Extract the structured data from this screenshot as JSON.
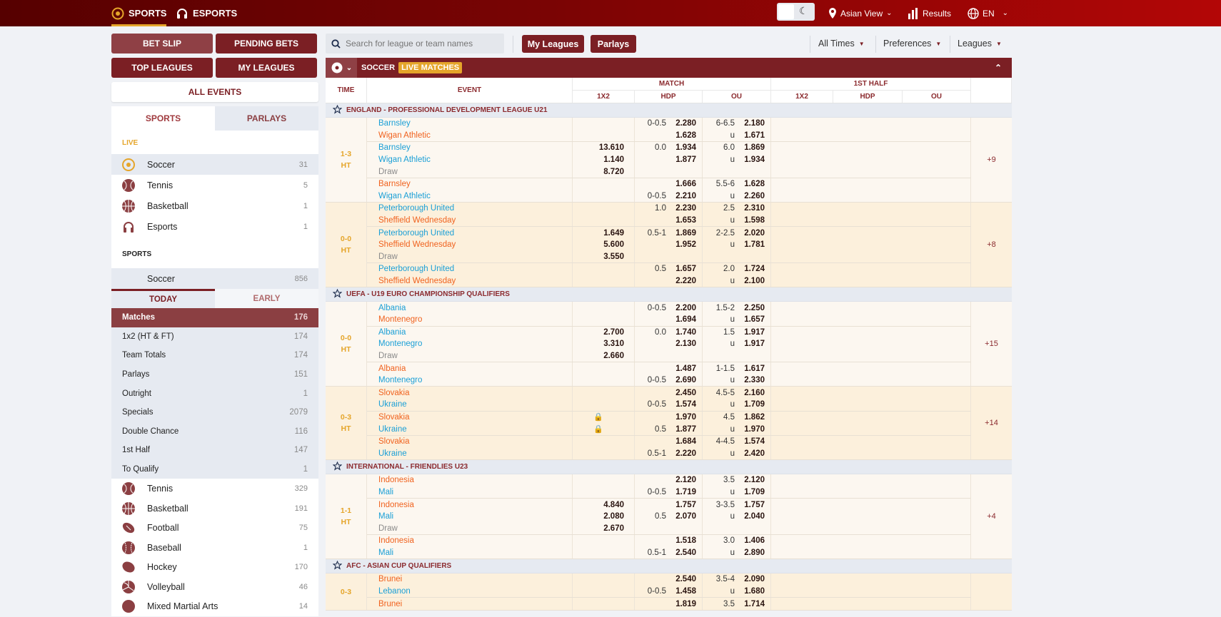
{
  "topbar": {
    "sports": "SPORTS",
    "esports": "ESPORTS",
    "view": "Asian View",
    "results": "Results",
    "lang": "EN"
  },
  "buttons": {
    "bet_slip": "BET SLIP",
    "pending_bets": "PENDING BETS",
    "top_leagues": "TOP LEAGUES",
    "my_leagues": "MY LEAGUES",
    "all_events": "ALL EVENTS"
  },
  "sidebar": {
    "tabs": [
      "SPORTS",
      "PARLAYS"
    ],
    "live_label": "LIVE",
    "live": [
      {
        "name": "Soccer",
        "count": "31",
        "icon": "soccer"
      },
      {
        "name": "Tennis",
        "count": "5",
        "icon": "tennis"
      },
      {
        "name": "Basketball",
        "count": "1",
        "icon": "basketball"
      },
      {
        "name": "Esports",
        "count": "1",
        "icon": "headset"
      }
    ],
    "sports_label": "SPORTS",
    "soccer": {
      "name": "Soccer",
      "count": "856"
    },
    "day_tabs": [
      "TODAY",
      "EARLY"
    ],
    "markets": [
      {
        "name": "Matches",
        "count": "176"
      },
      {
        "name": "1x2 (HT & FT)",
        "count": "174"
      },
      {
        "name": "Team Totals",
        "count": "174"
      },
      {
        "name": "Parlays",
        "count": "151"
      },
      {
        "name": "Outright",
        "count": "1"
      },
      {
        "name": "Specials",
        "count": "2079"
      },
      {
        "name": "Double Chance",
        "count": "116"
      },
      {
        "name": "1st Half",
        "count": "147"
      },
      {
        "name": "To Qualify",
        "count": "1"
      }
    ],
    "sports": [
      {
        "name": "Tennis",
        "count": "329",
        "icon": "tennis"
      },
      {
        "name": "Basketball",
        "count": "191",
        "icon": "basketball"
      },
      {
        "name": "Football",
        "count": "75",
        "icon": "football"
      },
      {
        "name": "Baseball",
        "count": "1",
        "icon": "baseball"
      },
      {
        "name": "Hockey",
        "count": "170",
        "icon": "hockey"
      },
      {
        "name": "Volleyball",
        "count": "46",
        "icon": "volleyball"
      },
      {
        "name": "Mixed Martial Arts",
        "count": "14",
        "icon": "mma"
      }
    ]
  },
  "filters": {
    "search_placeholder": "Search for league or team names",
    "my_leagues": "My Leagues",
    "parlays": "Parlays",
    "all_times": "All Times",
    "preferences": "Preferences",
    "leagues": "Leagues"
  },
  "colors": {
    "brand": "#7b1f24",
    "accent": "#e5a52a",
    "home": "#1a9fd6",
    "away": "#f0621e"
  },
  "table": {
    "sport": "SOCCER",
    "live_badge": "LIVE MATCHES",
    "headers": {
      "time": "TIME",
      "event": "EVENT",
      "match": "MATCH",
      "first_half": "1ST HALF",
      "x12": "1X2",
      "hdp": "HDP",
      "ou": "OU"
    },
    "leagues": [
      {
        "name": "ENGLAND - PROFESSIONAL DEVELOPMENT LEAGUE U21",
        "matches": [
          {
            "score": "1-3",
            "period": "HT",
            "more": "+9",
            "shade": "light",
            "markets": [
              [
                {
                  "team": "Barnsley",
                  "side": "home",
                  "hl": "0-0.5",
                  "hp": "2.280",
                  "ol": "6-6.5",
                  "op": "2.180"
                },
                {
                  "team": "Wigan Athletic",
                  "side": "away",
                  "hp": "1.628",
                  "ol": "u",
                  "op": "1.671"
                }
              ],
              [
                {
                  "team": "Barnsley",
                  "side": "home",
                  "x": "13.610",
                  "hl": "0.0",
                  "hp": "1.934",
                  "ol": "6.0",
                  "op": "1.869"
                },
                {
                  "team": "Wigan Athletic",
                  "side": "home",
                  "x": "1.140",
                  "hp": "1.877",
                  "ol": "u",
                  "op": "1.934"
                },
                {
                  "team": "Draw",
                  "side": "draw",
                  "x": "8.720"
                }
              ],
              [
                {
                  "team": "Barnsley",
                  "side": "away",
                  "hp": "1.666",
                  "ol": "5.5-6",
                  "op": "1.628"
                },
                {
                  "team": "Wigan Athletic",
                  "side": "home",
                  "hl": "0-0.5",
                  "hp": "2.210",
                  "ol": "u",
                  "op": "2.260"
                }
              ]
            ]
          },
          {
            "score": "0-0",
            "period": "HT",
            "more": "+8",
            "shade": "dark",
            "markets": [
              [
                {
                  "team": "Peterborough United",
                  "side": "home",
                  "hl": "1.0",
                  "hp": "2.230",
                  "ol": "2.5",
                  "op": "2.310"
                },
                {
                  "team": "Sheffield Wednesday",
                  "side": "away",
                  "hp": "1.653",
                  "ol": "u",
                  "op": "1.598"
                }
              ],
              [
                {
                  "team": "Peterborough United",
                  "side": "home",
                  "x": "1.649",
                  "hl": "0.5-1",
                  "hp": "1.869",
                  "ol": "2-2.5",
                  "op": "2.020"
                },
                {
                  "team": "Sheffield Wednesday",
                  "side": "away",
                  "x": "5.600",
                  "hp": "1.952",
                  "ol": "u",
                  "op": "1.781"
                },
                {
                  "team": "Draw",
                  "side": "draw",
                  "x": "3.550"
                }
              ],
              [
                {
                  "team": "Peterborough United",
                  "side": "home",
                  "hl": "0.5",
                  "hp": "1.657",
                  "ol": "2.0",
                  "op": "1.724"
                },
                {
                  "team": "Sheffield Wednesday",
                  "side": "away",
                  "hp": "2.220",
                  "ol": "u",
                  "op": "2.100"
                }
              ]
            ]
          }
        ]
      },
      {
        "name": "UEFA - U19 EURO CHAMPIONSHIP QUALIFIERS",
        "matches": [
          {
            "score": "0-0",
            "period": "HT",
            "more": "+15",
            "shade": "light",
            "markets": [
              [
                {
                  "team": "Albania",
                  "side": "home",
                  "hl": "0-0.5",
                  "hp": "2.200",
                  "ol": "1.5-2",
                  "op": "2.250"
                },
                {
                  "team": "Montenegro",
                  "side": "away",
                  "hp": "1.694",
                  "ol": "u",
                  "op": "1.657"
                }
              ],
              [
                {
                  "team": "Albania",
                  "side": "home",
                  "x": "2.700",
                  "hl": "0.0",
                  "hp": "1.740",
                  "ol": "1.5",
                  "op": "1.917"
                },
                {
                  "team": "Montenegro",
                  "side": "home",
                  "x": "3.310",
                  "hp": "2.130",
                  "ol": "u",
                  "op": "1.917"
                },
                {
                  "team": "Draw",
                  "side": "draw",
                  "x": "2.660"
                }
              ],
              [
                {
                  "team": "Albania",
                  "side": "away",
                  "hp": "1.487",
                  "ol": "1-1.5",
                  "op": "1.617"
                },
                {
                  "team": "Montenegro",
                  "side": "home",
                  "hl": "0-0.5",
                  "hp": "2.690",
                  "ol": "u",
                  "op": "2.330"
                }
              ]
            ]
          },
          {
            "score": "0-3",
            "period": "HT",
            "more": "+14",
            "shade": "dark",
            "markets": [
              [
                {
                  "team": "Slovakia",
                  "side": "away",
                  "hp": "2.450",
                  "ol": "4.5-5",
                  "op": "2.160"
                },
                {
                  "team": "Ukraine",
                  "side": "home",
                  "hl": "0-0.5",
                  "hp": "1.574",
                  "ol": "u",
                  "op": "1.709"
                }
              ],
              [
                {
                  "team": "Slovakia",
                  "side": "away",
                  "lock": true,
                  "hp": "1.970",
                  "ol": "4.5",
                  "op": "1.862"
                },
                {
                  "team": "Ukraine",
                  "side": "home",
                  "lock": true,
                  "hl": "0.5",
                  "hp": "1.877",
                  "ol": "u",
                  "op": "1.970"
                }
              ],
              [
                {
                  "team": "Slovakia",
                  "side": "away",
                  "hp": "1.684",
                  "ol": "4-4.5",
                  "op": "1.574"
                },
                {
                  "team": "Ukraine",
                  "side": "home",
                  "hl": "0.5-1",
                  "hp": "2.220",
                  "ol": "u",
                  "op": "2.420"
                }
              ]
            ]
          }
        ]
      },
      {
        "name": "INTERNATIONAL - FRIENDLIES U23",
        "matches": [
          {
            "score": "1-1",
            "period": "HT",
            "more": "+4",
            "shade": "light",
            "markets": [
              [
                {
                  "team": "Indonesia",
                  "side": "away",
                  "hp": "2.120",
                  "ol": "3.5",
                  "op": "2.120"
                },
                {
                  "team": "Mali",
                  "side": "home",
                  "hl": "0-0.5",
                  "hp": "1.719",
                  "ol": "u",
                  "op": "1.709"
                }
              ],
              [
                {
                  "team": "Indonesia",
                  "side": "away",
                  "x": "4.840",
                  "hp": "1.757",
                  "ol": "3-3.5",
                  "op": "1.757"
                },
                {
                  "team": "Mali",
                  "side": "home",
                  "x": "2.080",
                  "hl": "0.5",
                  "hp": "2.070",
                  "ol": "u",
                  "op": "2.040"
                },
                {
                  "team": "Draw",
                  "side": "draw",
                  "x": "2.670"
                }
              ],
              [
                {
                  "team": "Indonesia",
                  "side": "away",
                  "hp": "1.518",
                  "ol": "3.0",
                  "op": "1.406"
                },
                {
                  "team": "Mali",
                  "side": "home",
                  "hl": "0.5-1",
                  "hp": "2.540",
                  "ol": "u",
                  "op": "2.890"
                }
              ]
            ]
          }
        ]
      },
      {
        "name": "AFC - ASIAN CUP QUALIFIERS",
        "matches": [
          {
            "score": "0-3",
            "period": "",
            "more": "",
            "shade": "dark",
            "markets": [
              [
                {
                  "team": "Brunei",
                  "side": "away",
                  "hp": "2.540",
                  "ol": "3.5-4",
                  "op": "2.090"
                },
                {
                  "team": "Lebanon",
                  "side": "home",
                  "hl": "0-0.5",
                  "hp": "1.458",
                  "ol": "u",
                  "op": "1.680"
                }
              ],
              [
                {
                  "team": "Brunei",
                  "side": "away",
                  "hp": "1.819",
                  "ol": "3.5",
                  "op": "1.714"
                }
              ]
            ]
          }
        ]
      }
    ]
  }
}
